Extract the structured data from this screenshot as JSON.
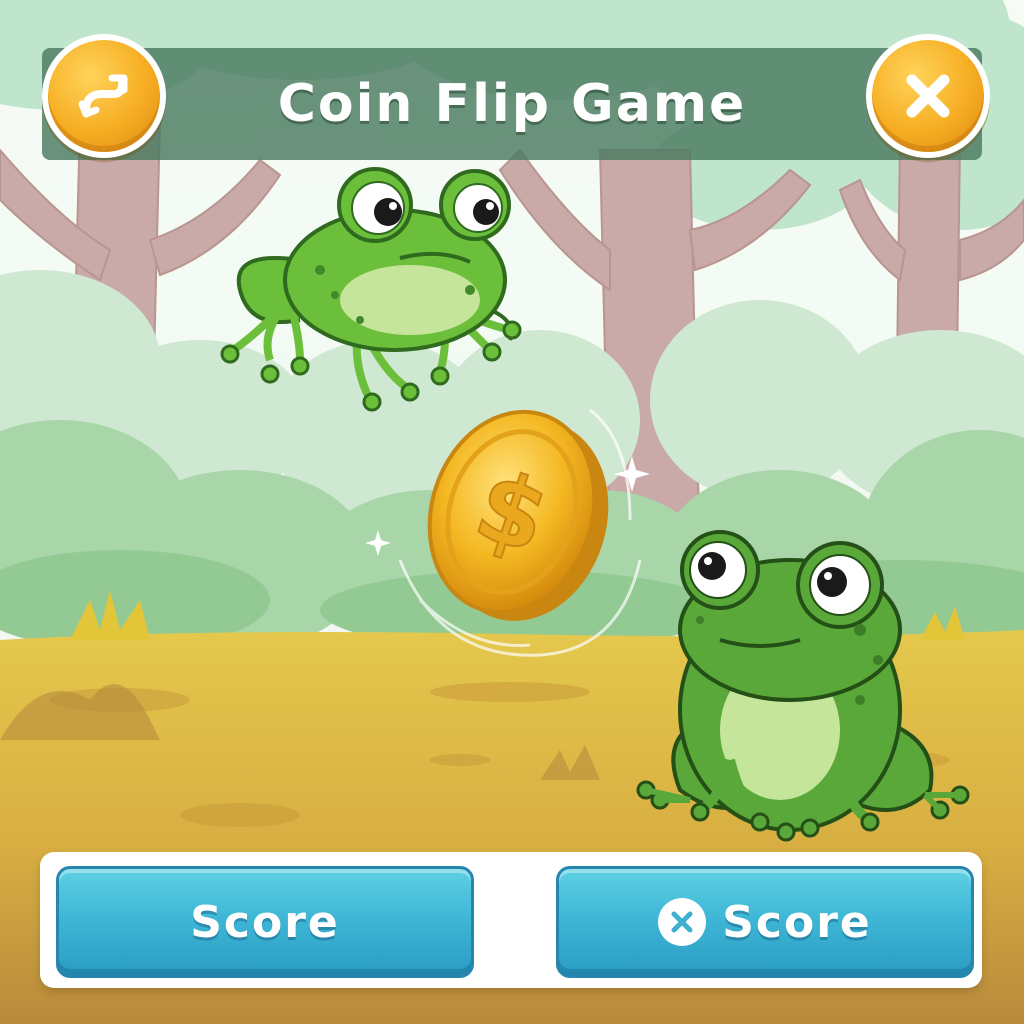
{
  "header": {
    "title": "Coin Flip Game",
    "restart_icon": "restart-arrow-icon",
    "close_icon": "close-x-icon"
  },
  "footer": {
    "left_button_label": "Score",
    "right_button_label": "Score",
    "right_button_icon": "x-circle-icon"
  },
  "colors": {
    "title_bar": "#4a7a60",
    "round_button": "#f6ad22",
    "score_button": "#3fb7d6",
    "coin": "#f2b51c",
    "frog": "#6cbf3b"
  }
}
